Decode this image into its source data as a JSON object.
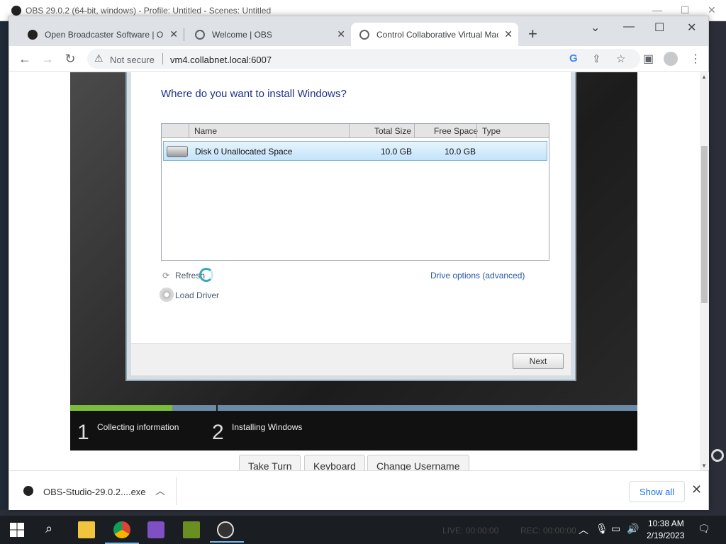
{
  "obs": {
    "title": "OBS 29.0.2 (64-bit, windows) - Profile: Untitled - Scenes: Untitled"
  },
  "chrome": {
    "tabs": [
      {
        "label": "Open Broadcaster Software | OBS",
        "active": false
      },
      {
        "label": "Welcome | OBS",
        "active": false
      },
      {
        "label": "Control Collaborative Virtual Machine",
        "active": true
      }
    ],
    "security_label": "Not secure",
    "url": "vm4.collabnet.local:6007"
  },
  "setup": {
    "heading": "Where do you want to install Windows?",
    "columns": {
      "name": "Name",
      "total": "Total Size",
      "free": "Free Space",
      "type": "Type"
    },
    "disks": [
      {
        "name": "Disk 0 Unallocated Space",
        "total": "10.0 GB",
        "free": "10.0 GB",
        "type": ""
      }
    ],
    "refresh_label": "Refresh",
    "load_driver_label": "Load Driver",
    "drive_options_label": "Drive options (advanced)",
    "next_label": "Next"
  },
  "installer_steps": [
    {
      "number": "1",
      "label": "Collecting information"
    },
    {
      "number": "2",
      "label": "Installing Windows"
    }
  ],
  "install_progress_fraction": 0.18,
  "vm_controls": {
    "take_turn": "Take Turn",
    "keyboard": "Keyboard",
    "change_username": "Change Username"
  },
  "download": {
    "filename": "OBS-Studio-29.0.2....exe",
    "show_all": "Show all"
  },
  "taskbar": {
    "live_status": "LIVE: 00:00:00",
    "rec_status": "REC: 00:00:00",
    "time": "10:38 AM",
    "date": "2/19/2023"
  },
  "colors": {
    "setup_heading": "#1e3287",
    "progress_done": "#7bbd3a",
    "progress_remaining": "#6c8aa7",
    "selected_row": "#c4e4f9",
    "show_all_link": "#1a73e8"
  }
}
